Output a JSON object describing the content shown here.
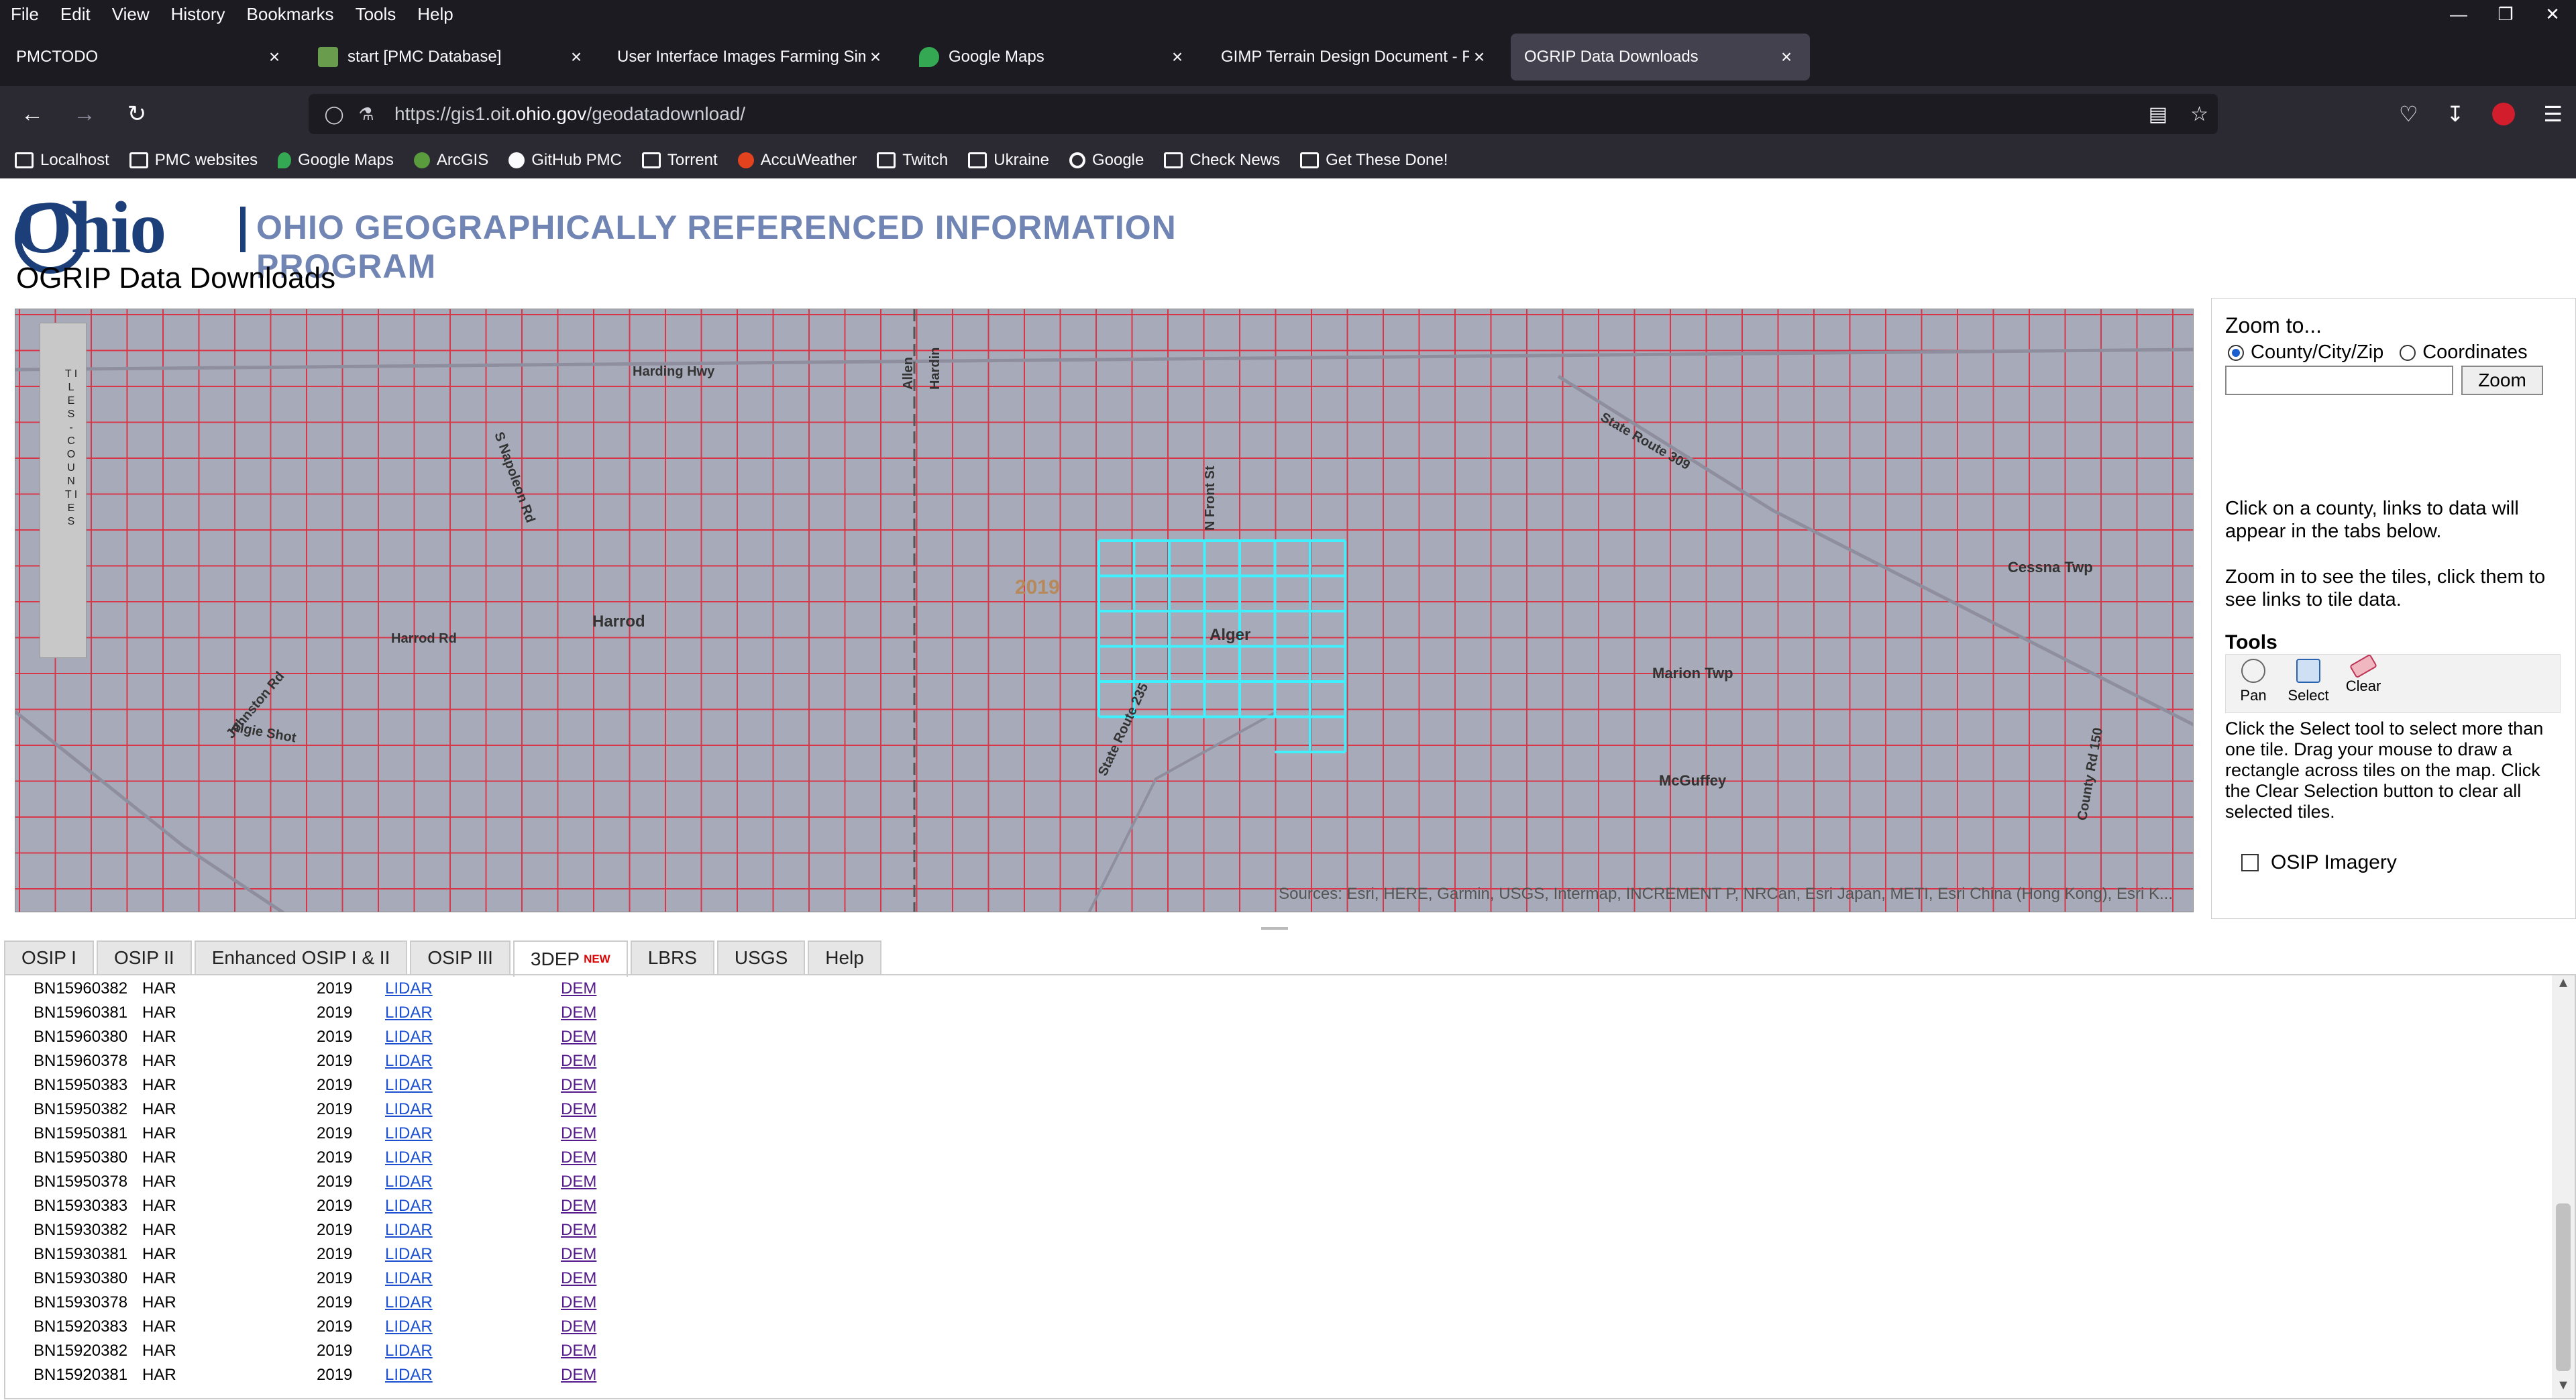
{
  "menu": [
    "File",
    "Edit",
    "View",
    "History",
    "Bookmarks",
    "Tools",
    "Help"
  ],
  "tabs": [
    {
      "label": "PMCTODO",
      "icon_color": ""
    },
    {
      "label": "start [PMC Database]",
      "icon_color": "#6a9c4e"
    },
    {
      "label": "User Interface Images Farming Simu",
      "icon_color": ""
    },
    {
      "label": "Google Maps",
      "icon_color": "#34a853"
    },
    {
      "label": "GIMP Terrain Design Document - Pl",
      "icon_color": ""
    },
    {
      "label": "OGRIP Data Downloads",
      "icon_color": ""
    }
  ],
  "url": {
    "prefix": "https://gis1.oit.",
    "domain": "ohio.gov",
    "path": "/geodatadownload/"
  },
  "bookmarks": [
    {
      "label": "Localhost",
      "icon": "folder-icon"
    },
    {
      "label": "PMC websites",
      "icon": "folder-icon"
    },
    {
      "label": "Google Maps",
      "icon": "map-pin-icon"
    },
    {
      "label": "ArcGIS",
      "icon": "arcgis-icon"
    },
    {
      "label": "GitHub PMC",
      "icon": "github-icon"
    },
    {
      "label": "Torrent",
      "icon": "folder-icon"
    },
    {
      "label": "AccuWeather",
      "icon": "sun-icon"
    },
    {
      "label": "Twitch",
      "icon": "folder-icon"
    },
    {
      "label": "Ukraine",
      "icon": "folder-icon"
    },
    {
      "label": "Google",
      "icon": "google-icon"
    },
    {
      "label": "Check News",
      "icon": "folder-icon"
    },
    {
      "label": "Get These Done!",
      "icon": "folder-icon"
    }
  ],
  "header": {
    "logo": "Ohio",
    "program": "OHIO GEOGRAPHICALLY REFERENCED INFORMATION PROGRAM",
    "title": "OGRIP Data Downloads"
  },
  "map": {
    "labels": [
      "Harding Hwy",
      "S Napoleon Rd",
      "Harrod",
      "Harrod Rd",
      "Johnston Rd",
      "Algie Shot",
      "Alger",
      "N Front St",
      "State Route 235",
      "State Route 309",
      "Marion Twp",
      "McGuffey",
      "Cessna Twp",
      "County Rd 150",
      "Allen",
      "Hardin"
    ],
    "year_label": "2019",
    "zoom_labels": "T I L E S - C O U N T I E S",
    "sources": "Sources: Esri, HERE, Garmin, USGS, Intermap, INCREMENT P, NRCan, Esri Japan, METI, Esri China (Hong Kong), Esri K..."
  },
  "panel": {
    "zoom_title": "Zoom to...",
    "radio1": "County/City/Zip",
    "radio2": "Coordinates",
    "zoom_button": "Zoom",
    "help1": "Click on a county, links to data will appear in the tabs below.",
    "help2": "Zoom in to see the tiles, click them to see links to tile data.",
    "tools_title": "Tools",
    "tools": [
      "Pan",
      "Select",
      "Clear"
    ],
    "tools_help": "Click the Select tool to select more than one tile. Drag your mouse to draw a rectangle across tiles on the map. Click the Clear Selection button to clear all selected tiles.",
    "osip_label": "OSIP Imagery"
  },
  "data_tabs": [
    "OSIP I",
    "OSIP II",
    "Enhanced OSIP I & II",
    "OSIP III",
    "3DEP",
    "LBRS",
    "USGS",
    "Help"
  ],
  "new_badge": "NEW",
  "rows": [
    [
      "BN15960382",
      "HAR",
      "2019",
      "LIDAR",
      "DEM"
    ],
    [
      "BN15960381",
      "HAR",
      "2019",
      "LIDAR",
      "DEM"
    ],
    [
      "BN15960380",
      "HAR",
      "2019",
      "LIDAR",
      "DEM"
    ],
    [
      "BN15960378",
      "HAR",
      "2019",
      "LIDAR",
      "DEM"
    ],
    [
      "BN15950383",
      "HAR",
      "2019",
      "LIDAR",
      "DEM"
    ],
    [
      "BN15950382",
      "HAR",
      "2019",
      "LIDAR",
      "DEM"
    ],
    [
      "BN15950381",
      "HAR",
      "2019",
      "LIDAR",
      "DEM"
    ],
    [
      "BN15950380",
      "HAR",
      "2019",
      "LIDAR",
      "DEM"
    ],
    [
      "BN15950378",
      "HAR",
      "2019",
      "LIDAR",
      "DEM"
    ],
    [
      "BN15930383",
      "HAR",
      "2019",
      "LIDAR",
      "DEM"
    ],
    [
      "BN15930382",
      "HAR",
      "2019",
      "LIDAR",
      "DEM"
    ],
    [
      "BN15930381",
      "HAR",
      "2019",
      "LIDAR",
      "DEM"
    ],
    [
      "BN15930380",
      "HAR",
      "2019",
      "LIDAR",
      "DEM"
    ],
    [
      "BN15930378",
      "HAR",
      "2019",
      "LIDAR",
      "DEM"
    ],
    [
      "BN15920383",
      "HAR",
      "2019",
      "LIDAR",
      "DEM"
    ],
    [
      "BN15920382",
      "HAR",
      "2019",
      "LIDAR",
      "DEM"
    ],
    [
      "BN15920381",
      "HAR",
      "2019",
      "LIDAR",
      "DEM"
    ]
  ]
}
